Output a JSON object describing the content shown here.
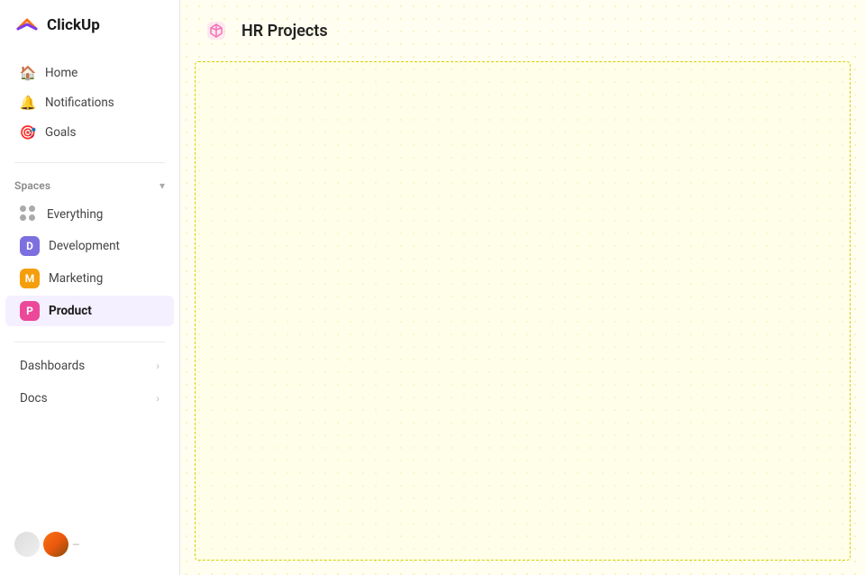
{
  "app": {
    "name": "ClickUp"
  },
  "sidebar": {
    "nav": [
      {
        "id": "home",
        "label": "Home",
        "icon": "🏠"
      },
      {
        "id": "notifications",
        "label": "Notifications",
        "icon": "🔔"
      },
      {
        "id": "goals",
        "label": "Goals",
        "icon": "🎯"
      }
    ],
    "spaces_section": {
      "label": "Spaces",
      "chevron": "▾"
    },
    "spaces": [
      {
        "id": "everything",
        "label": "Everything",
        "type": "dots"
      },
      {
        "id": "development",
        "label": "Development",
        "badge_letter": "D",
        "badge_color": "#7c6fe0"
      },
      {
        "id": "marketing",
        "label": "Marketing",
        "badge_letter": "M",
        "badge_color": "#f59e0b"
      },
      {
        "id": "product",
        "label": "Product",
        "badge_letter": "P",
        "badge_color": "#ec4899",
        "active": true
      }
    ],
    "extras": [
      {
        "id": "dashboards",
        "label": "Dashboards"
      },
      {
        "id": "docs",
        "label": "Docs"
      }
    ],
    "bottom": {
      "indicator": "—"
    }
  },
  "main": {
    "page_title": "HR Projects",
    "icon": "📦"
  }
}
